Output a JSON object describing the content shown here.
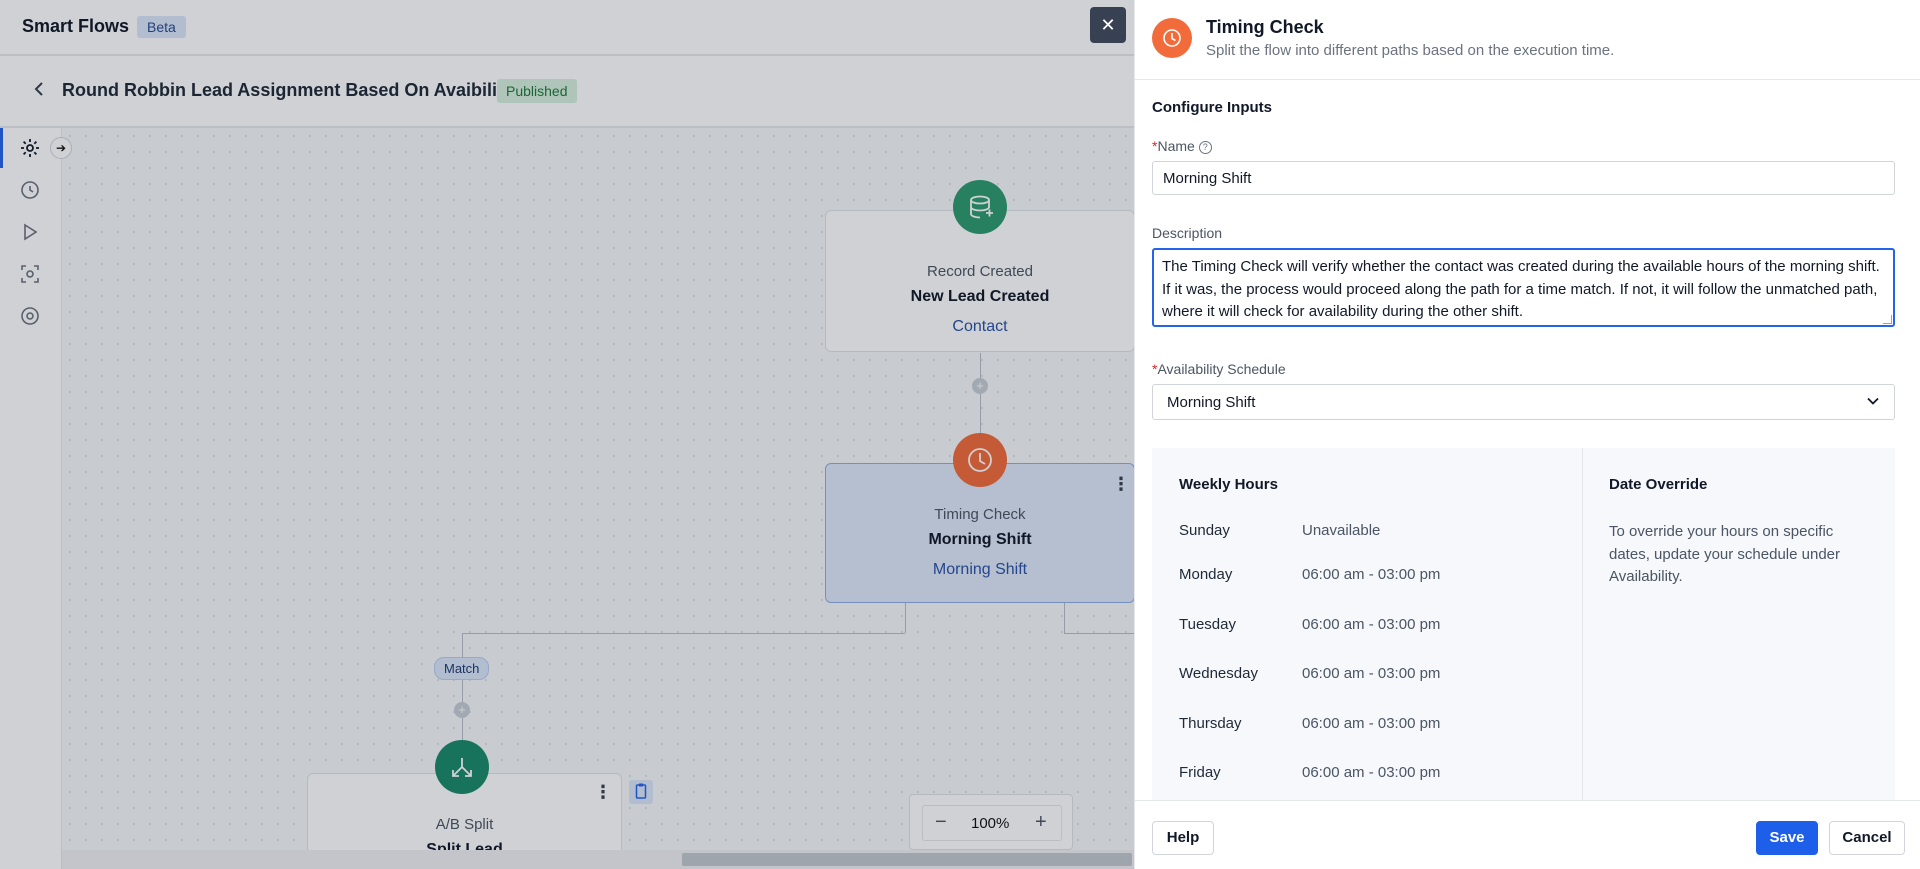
{
  "app": {
    "name": "Smart Flows",
    "badge": "Beta"
  },
  "flow": {
    "title": "Round Robbin Lead Assignment Based On Avaibility",
    "status": "Published"
  },
  "canvas": {
    "trigger_node": {
      "kind": "Record Created",
      "name": "New Lead Created",
      "sub": "Contact"
    },
    "timing_node": {
      "kind": "Timing Check",
      "name": "Morning Shift",
      "sub": "Morning Shift"
    },
    "split_node": {
      "kind": "A/B Split",
      "name": "Split Lead"
    },
    "match_label": "Match",
    "zoom": {
      "level": "100%"
    }
  },
  "panel": {
    "title": "Timing Check",
    "subtitle": "Split the flow into different paths based on the execution time.",
    "section_title": "Configure Inputs",
    "name_label": "Name",
    "name_value": "Morning Shift",
    "description_label": "Description",
    "description_value": "The Timing Check will verify whether the contact was created during the available hours of the morning shift. If it was, the process would proceed along the path for a time match. If not, it will follow the unmatched path, where it will check for availability during the other shift.",
    "schedule_label": "Availability Schedule",
    "schedule_value": "Morning Shift",
    "weekly": {
      "title": "Weekly Hours",
      "rows": [
        {
          "day": "Sunday",
          "hours": "Unavailable"
        },
        {
          "day": "Monday",
          "hours": "06:00 am - 03:00 pm"
        },
        {
          "day": "Tuesday",
          "hours": "06:00 am - 03:00 pm"
        },
        {
          "day": "Wednesday",
          "hours": "06:00 am - 03:00 pm"
        },
        {
          "day": "Thursday",
          "hours": "06:00 am - 03:00 pm"
        },
        {
          "day": "Friday",
          "hours": "06:00 am - 03:00 pm"
        }
      ]
    },
    "override": {
      "title": "Date Override",
      "text": "To override your hours on specific dates, update your schedule under Availability."
    },
    "buttons": {
      "help": "Help",
      "save": "Save",
      "cancel": "Cancel",
      "close": "✕"
    }
  },
  "colors": {
    "accent": "#1d5fe8",
    "timing": "#f26b3a",
    "trigger": "#2e9b6f",
    "split": "#1b8a6b"
  },
  "icons": [
    "settings-icon",
    "history-icon",
    "run-icon",
    "scan-icon",
    "at-icon",
    "clock-icon",
    "database-icon",
    "split-icon",
    "clipboard-icon"
  ]
}
